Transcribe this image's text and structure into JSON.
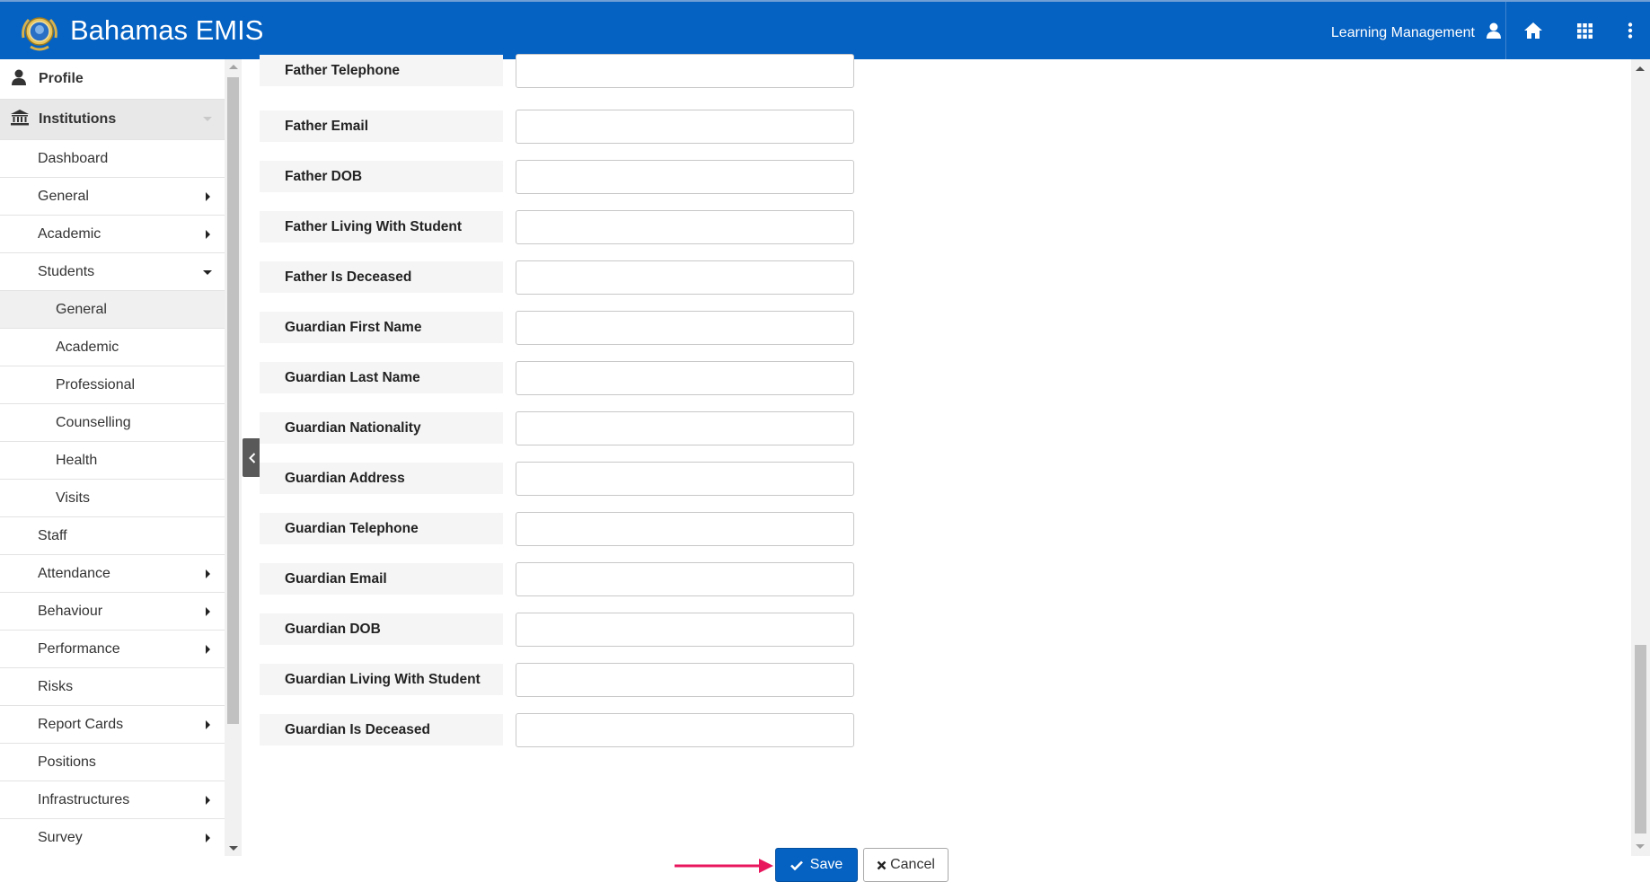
{
  "header": {
    "app_title": "Bahamas EMIS",
    "user_label": "Learning Management",
    "icons": [
      "user-icon",
      "home-icon",
      "apps-grid-icon",
      "more-vertical-icon"
    ],
    "brand_color": "#0561c2"
  },
  "sidebar": {
    "items": [
      {
        "label": "Profile",
        "level": "top",
        "icon": "user-icon"
      },
      {
        "label": "Institutions",
        "level": "top",
        "icon": "institution-icon",
        "expanded": true
      },
      {
        "label": "Dashboard",
        "level": 1
      },
      {
        "label": "General",
        "level": 1,
        "has_submenu": true
      },
      {
        "label": "Academic",
        "level": 1,
        "has_submenu": true
      },
      {
        "label": "Students",
        "level": 1,
        "expanded": true
      },
      {
        "label": "General",
        "level": 2,
        "selected": true
      },
      {
        "label": "Academic",
        "level": 2
      },
      {
        "label": "Professional",
        "level": 2
      },
      {
        "label": "Counselling",
        "level": 2
      },
      {
        "label": "Health",
        "level": 2
      },
      {
        "label": "Visits",
        "level": 2
      },
      {
        "label": "Staff",
        "level": 1
      },
      {
        "label": "Attendance",
        "level": 1,
        "has_submenu": true
      },
      {
        "label": "Behaviour",
        "level": 1,
        "has_submenu": true
      },
      {
        "label": "Performance",
        "level": 1,
        "has_submenu": true
      },
      {
        "label": "Risks",
        "level": 1
      },
      {
        "label": "Report Cards",
        "level": 1,
        "has_submenu": true
      },
      {
        "label": "Positions",
        "level": 1
      },
      {
        "label": "Infrastructures",
        "level": 1,
        "has_submenu": true
      },
      {
        "label": "Survey",
        "level": 1,
        "has_submenu": true
      }
    ]
  },
  "form": {
    "fields": [
      {
        "label": "Father Telephone",
        "value": ""
      },
      {
        "label": "Father Email",
        "value": ""
      },
      {
        "label": "Father DOB",
        "value": ""
      },
      {
        "label": "Father Living With Student",
        "value": ""
      },
      {
        "label": "Father Is Deceased",
        "value": ""
      },
      {
        "label": "Guardian First Name",
        "value": ""
      },
      {
        "label": "Guardian Last Name",
        "value": ""
      },
      {
        "label": "Guardian Nationality",
        "value": ""
      },
      {
        "label": "Guardian Address",
        "value": ""
      },
      {
        "label": "Guardian Telephone",
        "value": ""
      },
      {
        "label": "Guardian Email",
        "value": ""
      },
      {
        "label": "Guardian DOB",
        "value": ""
      },
      {
        "label": "Guardian Living With Student",
        "value": ""
      },
      {
        "label": "Guardian Is Deceased",
        "value": ""
      }
    ],
    "save_label": "Save",
    "cancel_label": "Cancel"
  },
  "annotation": {
    "arrow_color": "#e8175d",
    "points_to": "save-button"
  }
}
